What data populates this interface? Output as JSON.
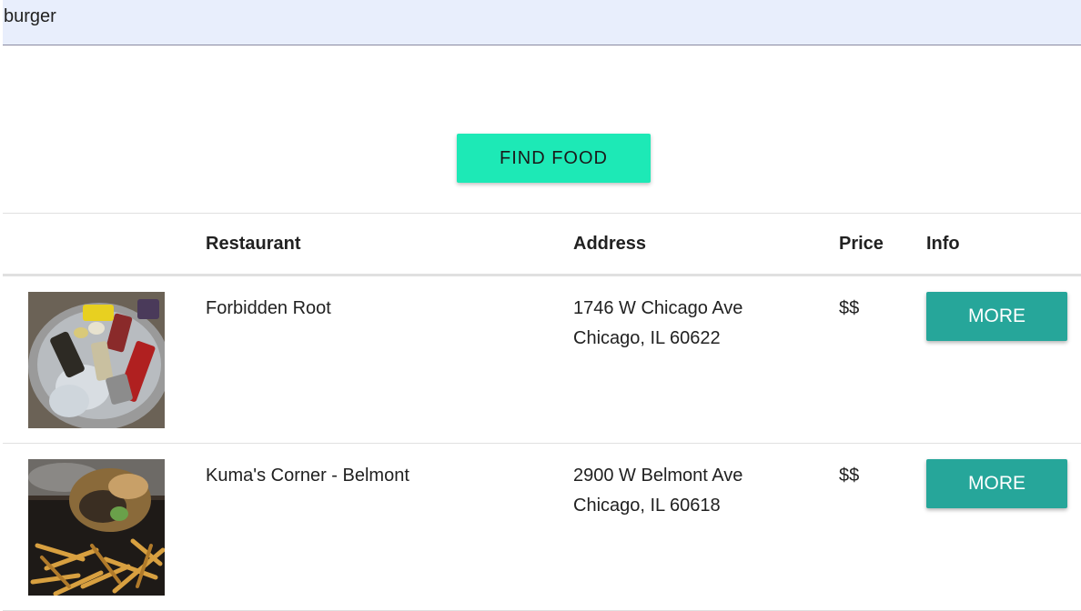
{
  "search": {
    "value": "burger",
    "placeholder": ""
  },
  "find_button_label": "FIND FOOD",
  "table": {
    "headers": {
      "image": "",
      "restaurant": "Restaurant",
      "address": "Address",
      "price": "Price",
      "info": "Info"
    },
    "rows": [
      {
        "name": "Forbidden Root",
        "address_line1": "1746 W Chicago Ave",
        "address_line2": "Chicago, IL 60622",
        "price": "$$",
        "more_label": "MORE",
        "image_subject": "bucket of beer cans on ice"
      },
      {
        "name": "Kuma's Corner - Belmont",
        "address_line1": "2900 W Belmont Ave",
        "address_line2": "Chicago, IL 60618",
        "price": "$$",
        "more_label": "MORE",
        "image_subject": "burger with fries in a container"
      }
    ]
  },
  "colors": {
    "search_bg": "#e8eefc",
    "find_button": "#1de9b6",
    "more_button": "#26a69a"
  }
}
